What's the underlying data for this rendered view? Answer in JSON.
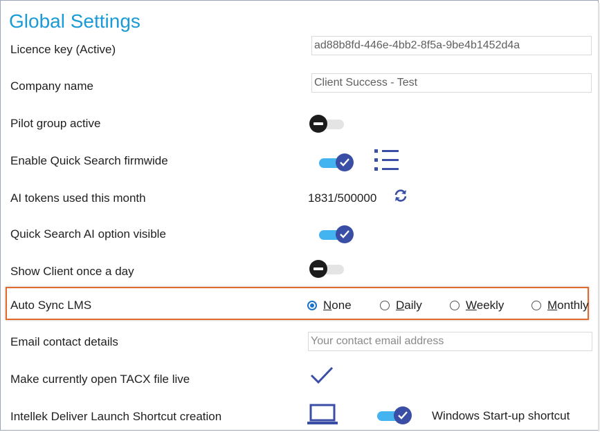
{
  "title": "Global Settings",
  "colors": {
    "accent": "#1a9ad6",
    "toggle_on": "#43b4f0",
    "knob_on": "#3b4ea6",
    "highlight": "#e26a2c"
  },
  "rows": {
    "licence_key": {
      "label": "Licence key (Active)",
      "value": "ad88b8fd-446e-4bb2-8f5a-9be4b1452d4a"
    },
    "company_name": {
      "label": "Company name",
      "value": "Client Success - Test"
    },
    "pilot_group": {
      "label": "Pilot group active",
      "state": "off"
    },
    "quick_search": {
      "label": "Enable Quick Search firmwide",
      "state": "on",
      "icon": "list-icon"
    },
    "ai_tokens": {
      "label": "AI tokens used this month",
      "value": "1831/500000",
      "icon": "refresh-icon"
    },
    "quick_search_ai": {
      "label": "Quick Search AI option visible",
      "state": "on"
    },
    "show_client": {
      "label": "Show Client once a day",
      "state": "off"
    },
    "auto_sync": {
      "label": "Auto Sync LMS",
      "selected": "None",
      "options": [
        {
          "first": "N",
          "rest": "one"
        },
        {
          "first": "D",
          "rest": "aily"
        },
        {
          "first": "W",
          "rest": "eekly"
        },
        {
          "first": "M",
          "rest": "onthly"
        }
      ]
    },
    "email_contact": {
      "label": "Email contact details",
      "placeholder": "Your contact email address",
      "value": ""
    },
    "tacx_live": {
      "label": "Make currently open TACX file live",
      "icon": "checkmark-icon"
    },
    "launch_shortcut": {
      "label": "Intellek Deliver Launch Shortcut creation",
      "icon": "laptop-icon",
      "state": "on",
      "startup_label": "Windows Start-up shortcut"
    }
  }
}
